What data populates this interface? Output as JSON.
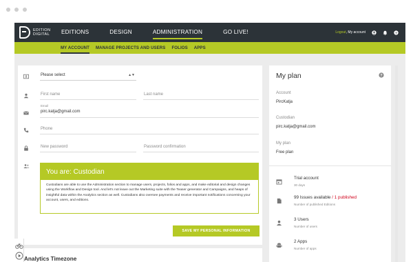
{
  "brand": {
    "line1": "EDITION",
    "line2": "DIGITAL"
  },
  "nav": {
    "items": [
      {
        "label": "EDITIONS"
      },
      {
        "label": "DESIGN"
      },
      {
        "label": "ADMINISTRATION"
      },
      {
        "label": "GO LIVE!"
      }
    ],
    "active_index": 2,
    "logout": "Logout",
    "account": "My account"
  },
  "subnav": {
    "items": [
      {
        "label": "MY ACCOUNT"
      },
      {
        "label": "MANAGE PROJECTS AND USERS"
      },
      {
        "label": "FOLIOS"
      },
      {
        "label": "APPS"
      }
    ],
    "active_index": 0
  },
  "form": {
    "select_placeholder": "Please select",
    "first_name_placeholder": "First name",
    "last_name_placeholder": "Last name",
    "email_label": "Email",
    "email_value": "pirc.katja@gmail.com",
    "phone_placeholder": "Phone",
    "new_password_placeholder": "New password",
    "password_confirm_placeholder": "Password confirmation",
    "role_title": "You are: Custodian",
    "role_description": "Custodians are able to use the Administration section to manage users, projects, folios and apps, and make editorial and design changes using the Workflow and Design tool. And let's not leave out the Marketing suite with the Teaser generator and Campaigns, and heaps of insightful data within the Analytics section as well. Custodians also oversee payments and receive important notifications concerning your account, users, and editions.",
    "save_label": "SAVE MY PERSONAL INFORMATION"
  },
  "next_section_title": "Analytics Timezone",
  "plan": {
    "title": "My plan",
    "account_label": "Account",
    "account_value": "PircKatja",
    "custodian_label": "Custodian",
    "custodian_value": "pirc.katja@gmail.com",
    "plan_label": "My plan",
    "plan_value": "Free plan",
    "stats": [
      {
        "value": "Trial account",
        "sub": "30 days"
      },
      {
        "value": "99 Issues available",
        "value_extra": " / 1 published",
        "sub": "Number of published Editions"
      },
      {
        "value": "3 Users",
        "sub": "Number of users"
      },
      {
        "value": "2 Apps",
        "sub": "Number of apps"
      }
    ]
  },
  "colors": {
    "accent": "#b5c925",
    "topbar": "#2c3338",
    "published": "#d0021b"
  }
}
